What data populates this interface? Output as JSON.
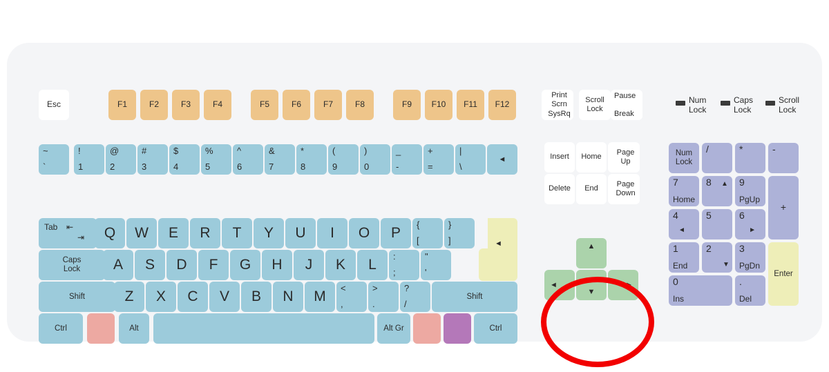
{
  "keyboard": {
    "colors": {
      "body": "#f4f5f7",
      "alpha_key": "#9ccbdb",
      "function_key": "#eec58a",
      "escape_key": "#ffffff",
      "enter_key": "#eeeeb8",
      "arrow_key": "#abd3ab",
      "numpad_key": "#adb2d8",
      "win_key": "#eda9a2",
      "menu_key": "#b478b9",
      "highlight": "#f20000"
    },
    "escape": {
      "label": "Esc"
    },
    "function_keys": [
      {
        "label": "F1"
      },
      {
        "label": "F2"
      },
      {
        "label": "F3"
      },
      {
        "label": "F4"
      },
      {
        "label": "F5"
      },
      {
        "label": "F6"
      },
      {
        "label": "F7"
      },
      {
        "label": "F8"
      },
      {
        "label": "F9"
      },
      {
        "label": "F10"
      },
      {
        "label": "F11"
      },
      {
        "label": "F12"
      }
    ],
    "number_row": [
      {
        "shift": "~",
        "base": "`"
      },
      {
        "shift": "!",
        "base": "1"
      },
      {
        "shift": "@",
        "base": "2"
      },
      {
        "shift": "#",
        "base": "3"
      },
      {
        "shift": "$",
        "base": "4"
      },
      {
        "shift": "%",
        "base": "5"
      },
      {
        "shift": "^",
        "base": "6"
      },
      {
        "shift": "&",
        "base": "7"
      },
      {
        "shift": "*",
        "base": "8"
      },
      {
        "shift": "(",
        "base": "9"
      },
      {
        "shift": ")",
        "base": "0"
      },
      {
        "shift": "_",
        "base": "-"
      },
      {
        "shift": "+",
        "base": "="
      }
    ],
    "backslash_key": {
      "shift": "|",
      "base": "\\"
    },
    "backspace": {
      "glyph": "◄"
    },
    "tab": {
      "label": "Tab",
      "glyph_top": "⇤",
      "glyph_bottom": "⇥"
    },
    "qwerty_row": [
      "Q",
      "W",
      "E",
      "R",
      "T",
      "Y",
      "U",
      "I",
      "O",
      "P"
    ],
    "bracket_keys": [
      {
        "shift": "{",
        "base": "["
      },
      {
        "shift": "}",
        "base": "]"
      }
    ],
    "enter": {
      "glyph": "◄"
    },
    "caps_lock": {
      "label": "Caps\nLock"
    },
    "asdf_row": [
      "A",
      "S",
      "D",
      "F",
      "G",
      "H",
      "J",
      "K",
      "L"
    ],
    "punct_keys": [
      {
        "shift": ":",
        "base": ";"
      },
      {
        "shift": "\"",
        "base": "'"
      }
    ],
    "shift_left": {
      "label": "Shift"
    },
    "zxcv_row": [
      "Z",
      "X",
      "C",
      "V",
      "B",
      "N",
      "M"
    ],
    "comma_keys": [
      {
        "shift": "<",
        "base": ","
      },
      {
        "shift": ">",
        "base": "."
      },
      {
        "shift": "?",
        "base": "/"
      }
    ],
    "shift_right": {
      "label": "Shift"
    },
    "bottom_row": {
      "ctrl_left": "Ctrl",
      "win_left": "",
      "alt_left": "Alt",
      "space": "",
      "alt_gr": "Alt Gr",
      "win_right": "",
      "menu": "",
      "ctrl_right": "Ctrl"
    }
  },
  "nav_cluster": {
    "print_screen": {
      "label": "Print\nScrn\nSysRq"
    },
    "scroll_lock": {
      "label": "Scroll\nLock"
    },
    "pause": {
      "top": "Pause",
      "bottom": "Break"
    },
    "insert": {
      "label": "Insert"
    },
    "home": {
      "label": "Home"
    },
    "page_up": {
      "label": "Page\nUp"
    },
    "delete": {
      "label": "Delete"
    },
    "end": {
      "label": "End"
    },
    "page_down": {
      "label": "Page\nDown"
    }
  },
  "arrow_cluster": {
    "up": {
      "glyph": "▲"
    },
    "left": {
      "glyph": "◄"
    },
    "down": {
      "glyph": "▼"
    },
    "right": {
      "glyph": "►"
    },
    "highlighted": true
  },
  "indicators": [
    {
      "label": "Num\nLock"
    },
    {
      "label": "Caps\nLock"
    },
    {
      "label": "Scroll\nLock"
    }
  ],
  "numpad": {
    "num_lock": {
      "label": "Num\nLock"
    },
    "divide": {
      "label": "/"
    },
    "multiply": {
      "label": "*"
    },
    "subtract": {
      "label": "-"
    },
    "key7": {
      "num": "7",
      "sub": "Home"
    },
    "key8": {
      "num": "8",
      "sub": "",
      "arrow": "▲"
    },
    "key9": {
      "num": "9",
      "sub": "PgUp"
    },
    "add": {
      "label": "+"
    },
    "key4": {
      "num": "4",
      "sub": "",
      "arrow": "◄"
    },
    "key5": {
      "num": "5",
      "sub": ""
    },
    "key6": {
      "num": "6",
      "sub": "",
      "arrow": "►"
    },
    "key1": {
      "num": "1",
      "sub": "End"
    },
    "key2": {
      "num": "2",
      "sub": "",
      "arrow": "▼"
    },
    "key3": {
      "num": "3",
      "sub": "PgDn"
    },
    "enter": {
      "label": "Enter"
    },
    "key0": {
      "num": "0",
      "sub": "Ins"
    },
    "decimal": {
      "num": ".",
      "sub": "Del"
    }
  }
}
